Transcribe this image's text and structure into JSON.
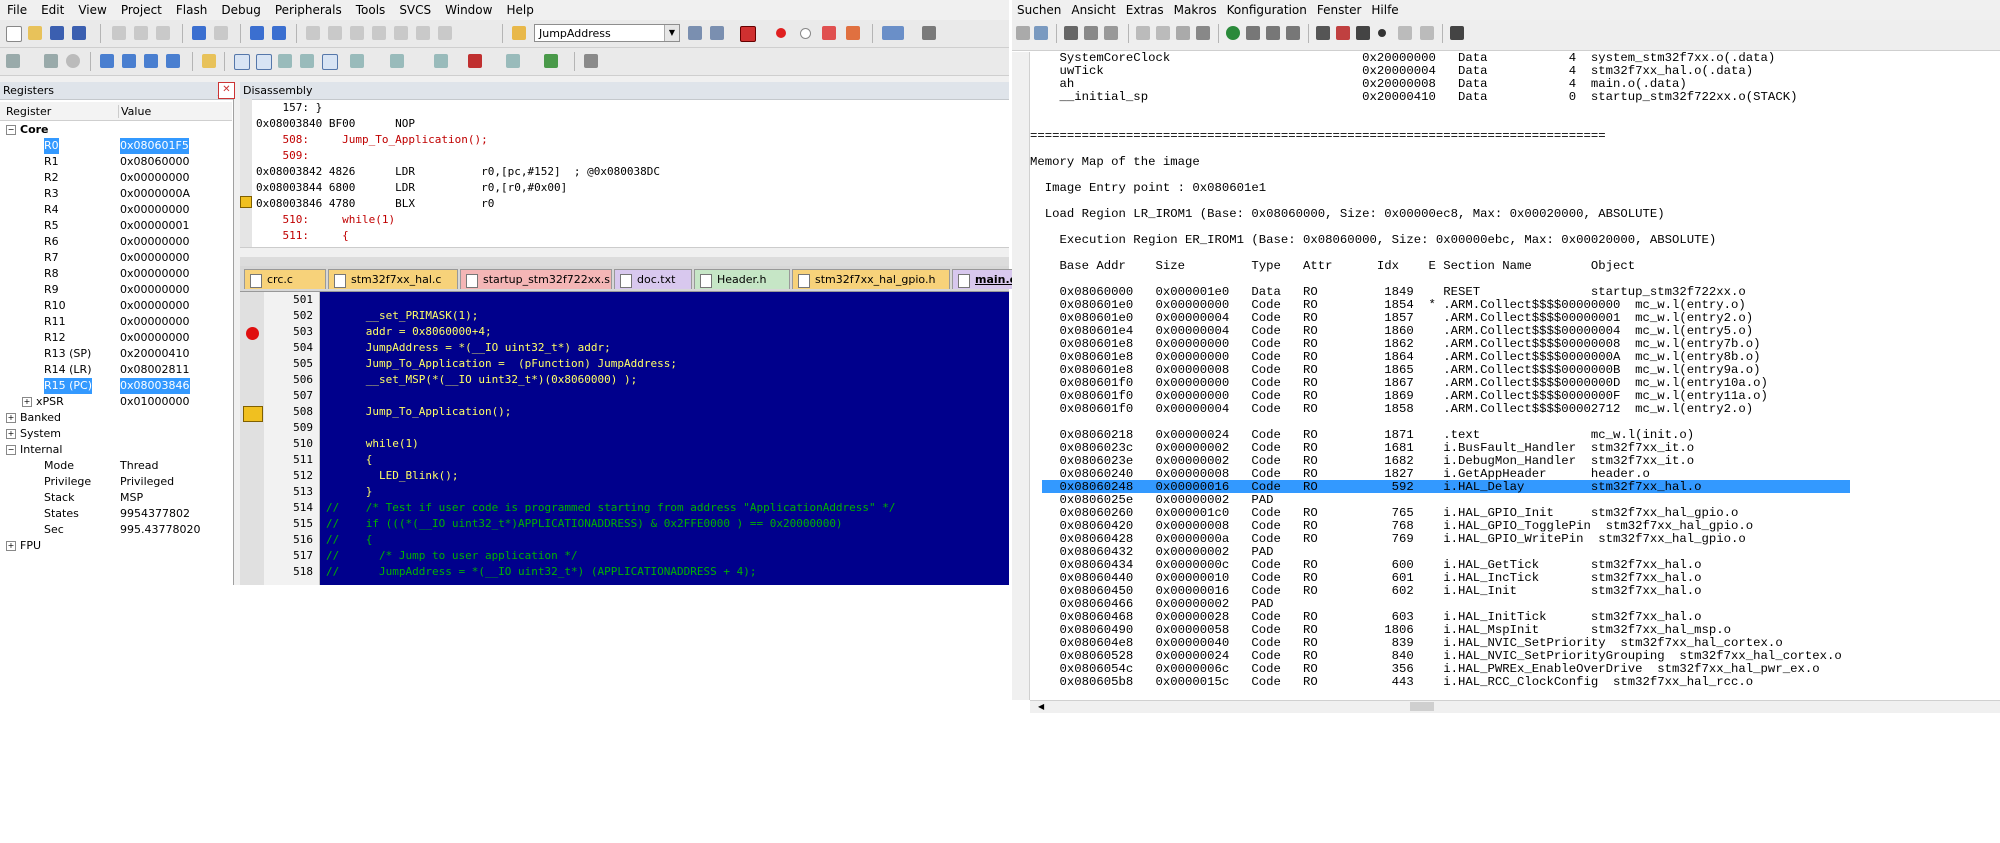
{
  "menubar": {
    "items": [
      "File",
      "Edit",
      "View",
      "Project",
      "Flash",
      "Debug",
      "Peripherals",
      "Tools",
      "SVCS",
      "Window",
      "Help"
    ]
  },
  "toolbar": {
    "combo_value": "JumpAddress"
  },
  "registers": {
    "title": "Registers",
    "col_register": "Register",
    "col_value": "Value",
    "rows": [
      {
        "name": "Core",
        "value": "",
        "level": 0,
        "bold": true,
        "box": "−"
      },
      {
        "name": "R0",
        "value": "0x080601F5",
        "level": 2,
        "selected": true
      },
      {
        "name": "R1",
        "value": "0x08060000",
        "level": 2
      },
      {
        "name": "R2",
        "value": "0x00000000",
        "level": 2
      },
      {
        "name": "R3",
        "value": "0x0000000A",
        "level": 2
      },
      {
        "name": "R4",
        "value": "0x00000000",
        "level": 2
      },
      {
        "name": "R5",
        "value": "0x00000001",
        "level": 2
      },
      {
        "name": "R6",
        "value": "0x00000000",
        "level": 2
      },
      {
        "name": "R7",
        "value": "0x00000000",
        "level": 2
      },
      {
        "name": "R8",
        "value": "0x00000000",
        "level": 2
      },
      {
        "name": "R9",
        "value": "0x00000000",
        "level": 2
      },
      {
        "name": "R10",
        "value": "0x00000000",
        "level": 2
      },
      {
        "name": "R11",
        "value": "0x00000000",
        "level": 2
      },
      {
        "name": "R12",
        "value": "0x00000000",
        "level": 2
      },
      {
        "name": "R13 (SP)",
        "value": "0x20000410",
        "level": 2
      },
      {
        "name": "R14 (LR)",
        "value": "0x08002811",
        "level": 2
      },
      {
        "name": "R15 (PC)",
        "value": "0x08003846",
        "level": 2,
        "selected": true
      },
      {
        "name": "xPSR",
        "value": "0x01000000",
        "level": 1,
        "box": "+"
      },
      {
        "name": "Banked",
        "value": "",
        "level": 0,
        "box": "+"
      },
      {
        "name": "System",
        "value": "",
        "level": 0,
        "box": "+"
      },
      {
        "name": "Internal",
        "value": "",
        "level": 0,
        "box": "−"
      },
      {
        "name": "Mode",
        "value": "Thread",
        "level": 2
      },
      {
        "name": "Privilege",
        "value": "Privileged",
        "level": 2
      },
      {
        "name": "Stack",
        "value": "MSP",
        "level": 2
      },
      {
        "name": "States",
        "value": "9954377802",
        "level": 2
      },
      {
        "name": "Sec",
        "value": "995.43778020",
        "level": 2
      },
      {
        "name": "FPU",
        "value": "",
        "level": 0,
        "box": "+"
      }
    ]
  },
  "disassembly": {
    "title": "Disassembly",
    "lines": [
      {
        "t": "    157: }",
        "c": "#000000"
      },
      {
        "t": "0x08003840 BF00      NOP",
        "c": "#000000"
      },
      {
        "t": "    508:     Jump_To_Application();",
        "c": "#c00000"
      },
      {
        "t": "    509:",
        "c": "#c00000"
      },
      {
        "t": "0x08003842 4826      LDR          r0,[pc,#152]  ; @0x080038DC",
        "c": "#000000"
      },
      {
        "t": "0x08003844 6800      LDR          r0,[r0,#0x00]",
        "c": "#000000"
      },
      {
        "t": "0x08003846 4780      BLX          r0",
        "c": "#000000"
      },
      {
        "t": "    510:     while(1)",
        "c": "#c00000"
      },
      {
        "t": "    511:     {",
        "c": "#c00000"
      }
    ]
  },
  "editor_tabs": [
    {
      "label": "crc.c",
      "color": "#f7d27a"
    },
    {
      "label": "stm32f7xx_hal.c",
      "color": "#f7d27a"
    },
    {
      "label": "startup_stm32f722xx.s",
      "color": "#f4b6b6"
    },
    {
      "label": "doc.txt",
      "color": "#d8c8ee"
    },
    {
      "label": "Header.h",
      "color": "#c6e6c6"
    },
    {
      "label": "stm32f7xx_hal_gpio.h",
      "color": "#f7d27a"
    },
    {
      "label": "main.c",
      "color": "#d8c8ee",
      "active": true
    }
  ],
  "editor": {
    "lines": [
      {
        "n": "501",
        "t": "",
        "c": "#ffff66"
      },
      {
        "n": "502",
        "t": "      __set_PRIMASK(1);",
        "c": "#ffff66"
      },
      {
        "n": "503",
        "t": "      addr = 0x8060000+4;",
        "c": "#ffff66"
      },
      {
        "n": "504",
        "t": "      JumpAddress = *(__IO uint32_t*) addr;",
        "c": "#ffff66"
      },
      {
        "n": "505",
        "t": "      Jump_To_Application =  (pFunction) JumpAddress;",
        "c": "#ffff66"
      },
      {
        "n": "506",
        "t": "      __set_MSP(*(__IO uint32_t*)(0x8060000) );",
        "c": "#ffff66"
      },
      {
        "n": "507",
        "t": "",
        "c": "#ffff66"
      },
      {
        "n": "508",
        "t": "      Jump_To_Application();",
        "c": "#ffff66"
      },
      {
        "n": "509",
        "t": "",
        "c": "#ffff66"
      },
      {
        "n": "510",
        "t": "      while(1)",
        "c": "#ffff66"
      },
      {
        "n": "511",
        "t": "      {",
        "c": "#ffff66"
      },
      {
        "n": "512",
        "t": "        LED_Blink();",
        "c": "#ffff66"
      },
      {
        "n": "513",
        "t": "      }",
        "c": "#ffff66"
      },
      {
        "n": "514",
        "t": "//    /* Test if user code is programmed starting from address \"ApplicationAddress\" */",
        "c": "#00b000"
      },
      {
        "n": "515",
        "t": "//    if (((*(__IO uint32_t*)APPLICATIONADDRESS) & 0x2FFE0000 ) == 0x20000000)",
        "c": "#00b000"
      },
      {
        "n": "516",
        "t": "//    {",
        "c": "#00b000"
      },
      {
        "n": "517",
        "t": "//      /* Jump to user application */",
        "c": "#00b000"
      },
      {
        "n": "518",
        "t": "//      JumpAddress = *(__IO uint32_t*) (APPLICATIONADDRESS + 4);",
        "c": "#00b000"
      }
    ]
  },
  "right_menu": {
    "items": [
      "Suchen",
      "Ansicht",
      "Extras",
      "Makros",
      "Konfiguration",
      "Fenster",
      "Hilfe"
    ]
  },
  "mapfile": {
    "lines": [
      "    SystemCoreClock                          0x20000000   Data           4  system_stm32f7xx.o(.data)",
      "    uwTick                                   0x20000004   Data           4  stm32f7xx_hal.o(.data)",
      "    ah                                       0x20000008   Data           4  main.o(.data)",
      "    __initial_sp                             0x20000410   Data           0  startup_stm32f722xx.o(STACK)",
      "",
      "",
      "==============================================================================",
      "",
      "Memory Map of the image",
      "",
      "  Image Entry point : 0x080601e1",
      "",
      "  Load Region LR_IROM1 (Base: 0x08060000, Size: 0x00000ec8, Max: 0x00020000, ABSOLUTE)",
      "",
      "    Execution Region ER_IROM1 (Base: 0x08060000, Size: 0x00000ebc, Max: 0x00020000, ABSOLUTE)",
      "",
      "    Base Addr    Size         Type   Attr      Idx    E Section Name        Object",
      "",
      "    0x08060000   0x000001e0   Data   RO         1849    RESET               startup_stm32f722xx.o",
      "    0x080601e0   0x00000000   Code   RO         1854  * .ARM.Collect$$$$00000000  mc_w.l(entry.o)",
      "    0x080601e0   0x00000004   Code   RO         1857    .ARM.Collect$$$$00000001  mc_w.l(entry2.o)",
      "    0x080601e4   0x00000004   Code   RO         1860    .ARM.Collect$$$$00000004  mc_w.l(entry5.o)",
      "    0x080601e8   0x00000000   Code   RO         1862    .ARM.Collect$$$$00000008  mc_w.l(entry7b.o)",
      "    0x080601e8   0x00000000   Code   RO         1864    .ARM.Collect$$$$0000000A  mc_w.l(entry8b.o)",
      "    0x080601e8   0x00000008   Code   RO         1865    .ARM.Collect$$$$0000000B  mc_w.l(entry9a.o)",
      "    0x080601f0   0x00000000   Code   RO         1867    .ARM.Collect$$$$0000000D  mc_w.l(entry10a.o)",
      "    0x080601f0   0x00000000   Code   RO         1869    .ARM.Collect$$$$0000000F  mc_w.l(entry11a.o)",
      "    0x080601f0   0x00000004   Code   RO         1858    .ARM.Collect$$$$00002712  mc_w.l(entry2.o)",
      "    0x080601f4   0x00000024   Code   RO         1850    .text               startup_stm32f722xx.o",
      "    0x08060218   0x00000024   Code   RO         1871    .text               mc_w.l(init.o)",
      "    0x0806023c   0x00000002   Code   RO         1681    i.BusFault_Handler  stm32f7xx_it.o",
      "    0x0806023e   0x00000002   Code   RO         1682    i.DebugMon_Handler  stm32f7xx_it.o",
      "    0x08060240   0x00000008   Code   RO         1827    i.GetAppHeader      header.o",
      "    0x08060248   0x00000016   Code   RO          592    i.HAL_Delay         stm32f7xx_hal.o",
      "    0x0806025e   0x00000002   PAD",
      "    0x08060260   0x000001c0   Code   RO          765    i.HAL_GPIO_Init     stm32f7xx_hal_gpio.o",
      "    0x08060420   0x00000008   Code   RO          768    i.HAL_GPIO_TogglePin  stm32f7xx_hal_gpio.o",
      "    0x08060428   0x0000000a   Code   RO          769    i.HAL_GPIO_WritePin  stm32f7xx_hal_gpio.o",
      "    0x08060432   0x00000002   PAD",
      "    0x08060434   0x0000000c   Code   RO          600    i.HAL_GetTick       stm32f7xx_hal.o",
      "    0x08060440   0x00000010   Code   RO          601    i.HAL_IncTick       stm32f7xx_hal.o",
      "    0x08060450   0x00000016   Code   RO          602    i.HAL_Init          stm32f7xx_hal.o",
      "    0x08060466   0x00000002   PAD",
      "    0x08060468   0x00000028   Code   RO          603    i.HAL_InitTick      stm32f7xx_hal.o",
      "    0x08060490   0x00000058   Code   RO         1806    i.HAL_MspInit       stm32f7xx_hal_msp.o",
      "    0x080604e8   0x00000040   Code   RO          839    i.HAL_NVIC_SetPriority  stm32f7xx_hal_cortex.o",
      "    0x08060528   0x00000024   Code   RO          840    i.HAL_NVIC_SetPriorityGrouping  stm32f7xx_hal_cortex.o",
      "    0x0806054c   0x0000006c   Code   RO          356    i.HAL_PWREx_EnableOverDrive  stm32f7xx_hal_pwr_ex.o",
      "    0x080605b8   0x0000015c   Code   RO          443    i.HAL_RCC_ClockConfig  stm32f7xx_hal_rcc.o"
    ]
  }
}
